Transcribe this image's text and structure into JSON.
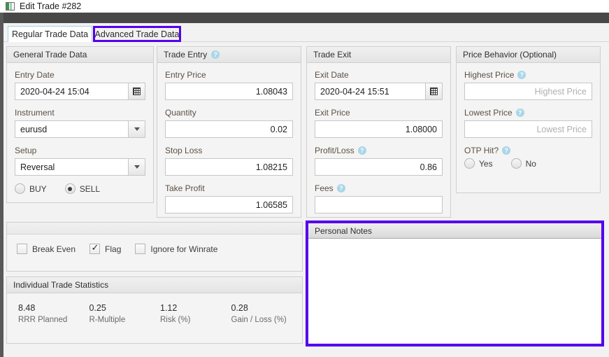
{
  "window": {
    "title": "Edit Trade #282",
    "icon": "app-icon"
  },
  "tabs": [
    {
      "label": "Regular Trade Data",
      "active": true
    },
    {
      "label": "Advanced Trade Data",
      "active": false,
      "highlighted": true
    }
  ],
  "panels": {
    "general": {
      "title": "General Trade Data",
      "entry_date_label": "Entry Date",
      "entry_date_value": "2020-04-24 15:04",
      "instrument_label": "Instrument",
      "instrument_value": "eurusd",
      "setup_label": "Setup",
      "setup_value": "Reversal",
      "direction_buy": "BUY",
      "direction_sell": "SELL",
      "direction_selected": "SELL"
    },
    "trade_entry": {
      "title": "Trade Entry",
      "help": "?",
      "entry_price_label": "Entry Price",
      "entry_price_value": "1.08043",
      "quantity_label": "Quantity",
      "quantity_value": "0.02",
      "stop_loss_label": "Stop Loss",
      "stop_loss_value": "1.08215",
      "take_profit_label": "Take Profit",
      "take_profit_value": "1.06585"
    },
    "trade_exit": {
      "title": "Trade Exit",
      "exit_date_label": "Exit Date",
      "exit_date_value": "2020-04-24 15:51",
      "exit_price_label": "Exit Price",
      "exit_price_value": "1.08000",
      "profit_loss_label": "Profit/Loss",
      "profit_loss_help": "?",
      "profit_loss_value": "0.86",
      "fees_label": "Fees",
      "fees_help": "?",
      "fees_value": ""
    },
    "price_behavior": {
      "title": "Price Behavior (Optional)",
      "highest_price_label": "Highest Price",
      "highest_price_help": "?",
      "highest_price_value": "",
      "highest_price_placeholder": "Highest Price",
      "lowest_price_label": "Lowest Price",
      "lowest_price_help": "?",
      "lowest_price_value": "",
      "lowest_price_placeholder": "Lowest Price",
      "otp_label": "OTP Hit?",
      "otp_help": "?",
      "otp_yes": "Yes",
      "otp_no": "No",
      "otp_selected": ""
    },
    "flags": {
      "break_even": {
        "label": "Break Even",
        "checked": false
      },
      "flag": {
        "label": "Flag",
        "checked": true
      },
      "ignore_winrate": {
        "label": "Ignore for Winrate",
        "checked": false
      }
    },
    "statistics": {
      "title": "Individual Trade Statistics",
      "items": [
        {
          "value": "8.48",
          "label": "RRR Planned"
        },
        {
          "value": "0.25",
          "label": "R-Multiple"
        },
        {
          "value": "1.12",
          "label": "Risk (%)"
        },
        {
          "value": "0.28",
          "label": "Gain / Loss (%)"
        }
      ]
    },
    "notes": {
      "title": "Personal Notes",
      "value": ""
    }
  },
  "colors": {
    "highlight": "#5500ee",
    "active_tab_border": "#9fd4e3",
    "help_icon": "#a9d6e8",
    "chrome_dark": "#484848"
  }
}
